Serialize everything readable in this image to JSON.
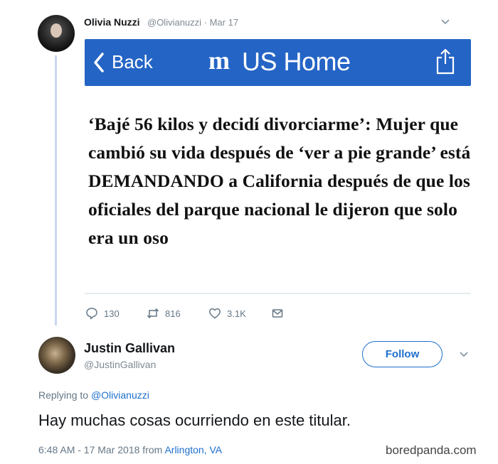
{
  "tweet1": {
    "name": "Olivia Nuzzi",
    "handle_date": "@Olivianuzzi · Mar 17",
    "card": {
      "back_label": "Back",
      "logo": "m",
      "site_label": "US Home",
      "bar_color": "#2464c5"
    },
    "headline": "‘Bajé 56 kilos y decidí divorciarme’: Mujer que cambió su vida después de ‘ver a pie grande’ está DEMANDANDO a California después de que los oficiales del parque nacional le dijeron que solo era un oso",
    "actions": {
      "replies": "130",
      "retweets": "816",
      "likes": "3.1K"
    }
  },
  "tweet2": {
    "name": "Justin Gallivan",
    "handle": "@JustinGallivan",
    "follow_label": "Follow",
    "replying_prefix": "Replying to",
    "replying_mention": "@Olivianuzzi",
    "text": "Hay muchas cosas ocurriendo en este titular.",
    "meta_time": "6:48 AM - 17 Mar 2018 from",
    "meta_location": "Arlington, VA",
    "accent_color": "#1e6fcd"
  },
  "watermark": "boredpanda.com"
}
